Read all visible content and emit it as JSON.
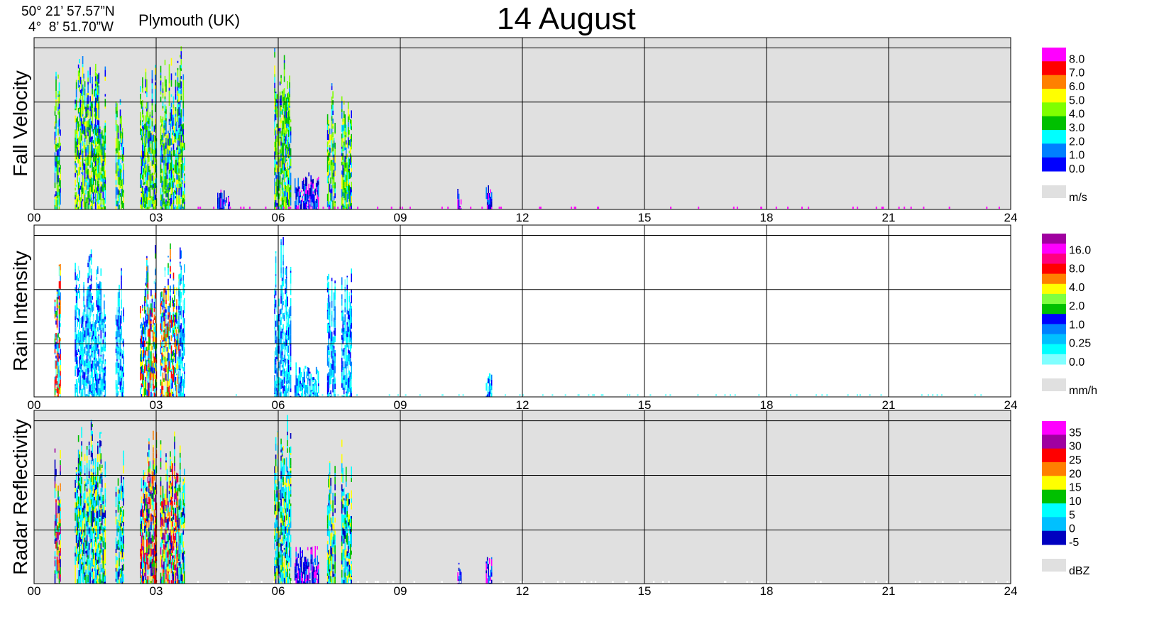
{
  "header": {
    "latitude": "50° 21’ 57.57”N",
    "longitude": "4°  8’ 51.70”W",
    "location": "Plymouth (UK)",
    "title": "14 August"
  },
  "chart_data": [
    {
      "type": "heatmap",
      "ylabel": "Fall Velocity",
      "background": "grey",
      "x_ticks": [
        "00",
        "03",
        "06",
        "09",
        "12",
        "15",
        "18",
        "21",
        "24"
      ],
      "xlim": [
        0,
        24
      ],
      "colorbar": {
        "unit": "m/s",
        "labels": [
          "8.0",
          "7.0",
          "6.0",
          "5.0",
          "4.0",
          "3.0",
          "2.0",
          "1.0",
          "0.0"
        ],
        "colors": [
          "#ff00ff",
          "#ff0000",
          "#ff8000",
          "#ffff00",
          "#80ff00",
          "#00c000",
          "#00ffff",
          "#0080ff",
          "#0000ff"
        ]
      },
      "rain_events": [
        {
          "start": 0.5,
          "end": 0.65,
          "top": 0.88,
          "palette": "velocity"
        },
        {
          "start": 1.0,
          "end": 1.5,
          "top": 0.97,
          "palette": "velocity"
        },
        {
          "start": 1.5,
          "end": 1.75,
          "top": 0.93,
          "palette": "velocity"
        },
        {
          "start": 2.0,
          "end": 2.2,
          "top": 0.8,
          "palette": "velocity"
        },
        {
          "start": 2.6,
          "end": 3.0,
          "top": 0.96,
          "palette": "velocity"
        },
        {
          "start": 3.1,
          "end": 3.55,
          "top": 0.92,
          "palette": "velocity"
        },
        {
          "start": 3.55,
          "end": 3.7,
          "top": 0.95,
          "palette": "velocity"
        },
        {
          "start": 4.5,
          "end": 4.8,
          "top": 0.12,
          "palette": "low"
        },
        {
          "start": 5.9,
          "end": 6.3,
          "top": 0.99,
          "palette": "velocity"
        },
        {
          "start": 6.4,
          "end": 7.0,
          "top": 0.22,
          "palette": "low"
        },
        {
          "start": 7.2,
          "end": 7.4,
          "top": 0.75,
          "palette": "velocity"
        },
        {
          "start": 7.55,
          "end": 7.8,
          "top": 0.85,
          "palette": "velocity"
        },
        {
          "start": 10.4,
          "end": 10.5,
          "top": 0.12,
          "palette": "low"
        },
        {
          "start": 11.1,
          "end": 11.25,
          "top": 0.16,
          "palette": "low"
        }
      ]
    },
    {
      "type": "heatmap",
      "ylabel": "Rain Intensity",
      "background": "white",
      "x_ticks": [
        "00",
        "03",
        "06",
        "09",
        "12",
        "15",
        "18",
        "21",
        "24"
      ],
      "xlim": [
        0,
        24
      ],
      "colorbar": {
        "unit": "mm/h",
        "labels": [
          "16.0",
          "8.0",
          "4.0",
          "2.0",
          "1.0",
          "0.25",
          "0.0"
        ],
        "colors": [
          "#a000a0",
          "#ff00ff",
          "#ff0080",
          "#ff0000",
          "#ff8000",
          "#ffff00",
          "#80ff40",
          "#00c000",
          "#0000ff",
          "#0080ff",
          "#00c0ff",
          "#00ffff",
          "#80ffff"
        ]
      },
      "rain_events": [
        {
          "start": 0.5,
          "end": 0.65,
          "top": 0.8,
          "palette": "rain_strong"
        },
        {
          "start": 1.0,
          "end": 1.5,
          "top": 0.92,
          "palette": "rain"
        },
        {
          "start": 1.5,
          "end": 1.75,
          "top": 0.8,
          "palette": "rain"
        },
        {
          "start": 2.0,
          "end": 2.2,
          "top": 0.75,
          "palette": "rain"
        },
        {
          "start": 2.6,
          "end": 3.0,
          "top": 0.92,
          "palette": "rain_strong"
        },
        {
          "start": 3.1,
          "end": 3.55,
          "top": 0.9,
          "palette": "rain_strong"
        },
        {
          "start": 3.55,
          "end": 3.7,
          "top": 0.95,
          "palette": "rain"
        },
        {
          "start": 5.9,
          "end": 6.3,
          "top": 0.99,
          "palette": "rain"
        },
        {
          "start": 6.4,
          "end": 7.0,
          "top": 0.22,
          "palette": "rain"
        },
        {
          "start": 7.2,
          "end": 7.4,
          "top": 0.75,
          "palette": "rain"
        },
        {
          "start": 7.55,
          "end": 7.8,
          "top": 0.85,
          "palette": "rain"
        },
        {
          "start": 11.1,
          "end": 11.25,
          "top": 0.16,
          "palette": "rain"
        }
      ]
    },
    {
      "type": "heatmap",
      "ylabel": "Radar Reflectivity",
      "background": "grey",
      "x_ticks": [
        "00",
        "03",
        "06",
        "09",
        "12",
        "15",
        "18",
        "21",
        "24"
      ],
      "xlim": [
        0,
        24
      ],
      "colorbar": {
        "unit": "dBZ",
        "labels": [
          "35",
          "30",
          "25",
          "20",
          "15",
          "10",
          "5",
          "0",
          "-5"
        ],
        "colors": [
          "#ff00ff",
          "#a000a0",
          "#ff0000",
          "#ff8000",
          "#ffff00",
          "#00c000",
          "#00ffff",
          "#00c0ff",
          "#0000c0"
        ]
      },
      "rain_events": [
        {
          "start": 0.5,
          "end": 0.65,
          "top": 0.85,
          "palette": "dbz_strong"
        },
        {
          "start": 1.0,
          "end": 1.5,
          "top": 0.97,
          "palette": "dbz"
        },
        {
          "start": 1.5,
          "end": 1.75,
          "top": 0.93,
          "palette": "dbz"
        },
        {
          "start": 2.0,
          "end": 2.2,
          "top": 0.8,
          "palette": "dbz"
        },
        {
          "start": 2.6,
          "end": 3.0,
          "top": 0.96,
          "palette": "dbz_strong"
        },
        {
          "start": 3.1,
          "end": 3.55,
          "top": 0.92,
          "palette": "dbz_strong"
        },
        {
          "start": 3.55,
          "end": 3.7,
          "top": 0.95,
          "palette": "dbz"
        },
        {
          "start": 5.9,
          "end": 6.3,
          "top": 0.99,
          "palette": "dbz"
        },
        {
          "start": 6.4,
          "end": 7.0,
          "top": 0.22,
          "palette": "low"
        },
        {
          "start": 7.2,
          "end": 7.4,
          "top": 0.75,
          "palette": "dbz"
        },
        {
          "start": 7.55,
          "end": 7.8,
          "top": 0.85,
          "palette": "dbz"
        },
        {
          "start": 10.4,
          "end": 10.5,
          "top": 0.12,
          "palette": "low"
        },
        {
          "start": 11.1,
          "end": 11.25,
          "top": 0.16,
          "palette": "low"
        }
      ]
    }
  ],
  "palettes": {
    "velocity": [
      "#0000ff",
      "#0080ff",
      "#00ffff",
      "#00c000",
      "#80ff00",
      "#ffff00",
      "#00c000",
      "#80ff00"
    ],
    "low": [
      "#0000ff",
      "#0000c0",
      "#0080ff",
      "#ff00ff"
    ],
    "rain": [
      "#80ffff",
      "#00ffff",
      "#00c0ff",
      "#0080ff",
      "#0000ff",
      "#00ffff"
    ],
    "rain_strong": [
      "#80ffff",
      "#00ffff",
      "#0000ff",
      "#ff0000",
      "#ff8000",
      "#ffff00",
      "#00c000",
      "#0080ff"
    ],
    "dbz": [
      "#00ffff",
      "#00c0ff",
      "#00c000",
      "#ffff00",
      "#0000c0",
      "#00ffff"
    ],
    "dbz_strong": [
      "#ff0000",
      "#ff8000",
      "#ffff00",
      "#00c000",
      "#00ffff",
      "#0000c0",
      "#a000a0"
    ]
  }
}
